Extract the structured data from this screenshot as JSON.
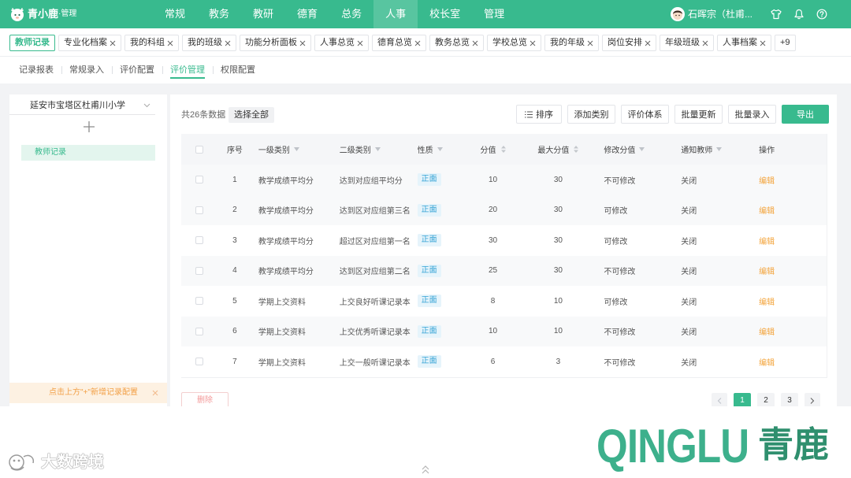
{
  "app": {
    "name": "青小鹿",
    "suffix": "·管理"
  },
  "nav": {
    "items": [
      {
        "label": "常规"
      },
      {
        "label": "教务"
      },
      {
        "label": "教研"
      },
      {
        "label": "德育"
      },
      {
        "label": "总务"
      },
      {
        "label": "人事",
        "active": true
      },
      {
        "label": "校长室"
      },
      {
        "label": "管理"
      }
    ]
  },
  "user": {
    "name": "石晖宗（杜甫..."
  },
  "icons": {
    "logo": "deer-logo-icon",
    "avatar": "user-avatar",
    "theme": "shirt-icon",
    "notifications": "bell-icon",
    "help": "help-icon",
    "tab_close": "close-icon",
    "filter": "filter-icon",
    "sort": "sort-icon",
    "add": "plus-icon",
    "dropdown": "chevron-down-icon",
    "sort_button": "list-icon"
  },
  "tabs": {
    "items": [
      {
        "label": "教师记录",
        "active": true,
        "closable": false
      },
      {
        "label": "专业化档案",
        "closable": true
      },
      {
        "label": "我的科组",
        "closable": true
      },
      {
        "label": "我的班级",
        "closable": true
      },
      {
        "label": "功能分析面板",
        "closable": true
      },
      {
        "label": "人事总览",
        "closable": true
      },
      {
        "label": "德育总览",
        "closable": true
      },
      {
        "label": "教务总览",
        "closable": true
      },
      {
        "label": "学校总览",
        "closable": true
      },
      {
        "label": "我的年级",
        "closable": true
      },
      {
        "label": "岗位安排",
        "closable": true
      },
      {
        "label": "年级班级",
        "closable": true
      },
      {
        "label": "人事档案",
        "closable": true
      }
    ],
    "more_label": "+9"
  },
  "subnav": {
    "items": [
      {
        "label": "记录报表"
      },
      {
        "label": "常规录入"
      },
      {
        "label": "评价配置"
      },
      {
        "label": "评价管理",
        "active": true
      },
      {
        "label": "权限配置"
      }
    ]
  },
  "sidebar": {
    "school": "延安市宝塔区杜甫川小学",
    "items": [
      {
        "label": "教师记录",
        "selected": true
      }
    ],
    "hint": "点击上方\"+\"新增记录配置"
  },
  "toolbar": {
    "total": "共26条数据",
    "select_all": "选择全部",
    "sort": "排序",
    "add_category": "添加类别",
    "evaluation_system": "评价体系",
    "batch_update": "批量更新",
    "batch_entry": "批量录入",
    "export": "导出"
  },
  "table": {
    "columns": [
      {
        "type": "checkbox"
      },
      {
        "label": "序号"
      },
      {
        "label": "一级类别",
        "filter": true
      },
      {
        "label": "二级类别",
        "filter": true
      },
      {
        "label": "性质",
        "filter": true
      },
      {
        "label": "分值",
        "sortable": true
      },
      {
        "label": "最大分值",
        "sortable": true
      },
      {
        "label": "修改分值",
        "filter": true
      },
      {
        "label": "通知教师",
        "filter": true
      },
      {
        "label": "操作"
      }
    ],
    "rows": [
      {
        "no": 1,
        "category1": "教学成绩平均分",
        "category2": "达到对应组平均分",
        "nature": "正面",
        "score": 10,
        "max_score": 30,
        "editable": "不可修改",
        "notify": "关闭",
        "action": "编辑"
      },
      {
        "no": 2,
        "category1": "教学成绩平均分",
        "category2": "达到区对应组第三名",
        "nature": "正面",
        "score": 20,
        "max_score": 30,
        "editable": "可修改",
        "notify": "关闭",
        "action": "编辑"
      },
      {
        "no": 3,
        "category1": "教学成绩平均分",
        "category2": "超过区对应组第一名",
        "nature": "正面",
        "score": 30,
        "max_score": 30,
        "editable": "可修改",
        "notify": "关闭",
        "action": "编辑"
      },
      {
        "no": 4,
        "category1": "教学成绩平均分",
        "category2": "达到区对应组第二名",
        "nature": "正面",
        "score": 25,
        "max_score": 30,
        "editable": "不可修改",
        "notify": "关闭",
        "action": "编辑"
      },
      {
        "no": 5,
        "category1": "学期上交资料",
        "category2": "上交良好听课记录本",
        "nature": "正面",
        "score": 8,
        "max_score": 10,
        "editable": "可修改",
        "notify": "关闭",
        "action": "编辑"
      },
      {
        "no": 6,
        "category1": "学期上交资料",
        "category2": "上交优秀听课记录本",
        "nature": "正面",
        "score": 10,
        "max_score": 10,
        "editable": "不可修改",
        "notify": "关闭",
        "action": "编辑"
      },
      {
        "no": 7,
        "category1": "学期上交资料",
        "category2": "上交一般听课记录本",
        "nature": "正面",
        "score": 6,
        "max_score": 3,
        "editable": "不可修改",
        "notify": "关闭",
        "action": "编辑"
      }
    ]
  },
  "footer": {
    "delete": "删除",
    "pagination": {
      "pages": [
        {
          "label": "1",
          "current": true
        },
        {
          "label": "2"
        },
        {
          "label": "3"
        }
      ]
    }
  },
  "branding": {
    "latin": "QINGLU",
    "cjk": "青鹿"
  },
  "watermark": {
    "text": "大数跨境"
  },
  "colors": {
    "primary": "#38ba8e",
    "positive_tag": "#35a3d5",
    "edit_link": "#f3a43b",
    "brand_latin": "#3db08c",
    "brand_cjk": "#2f8f6e"
  }
}
